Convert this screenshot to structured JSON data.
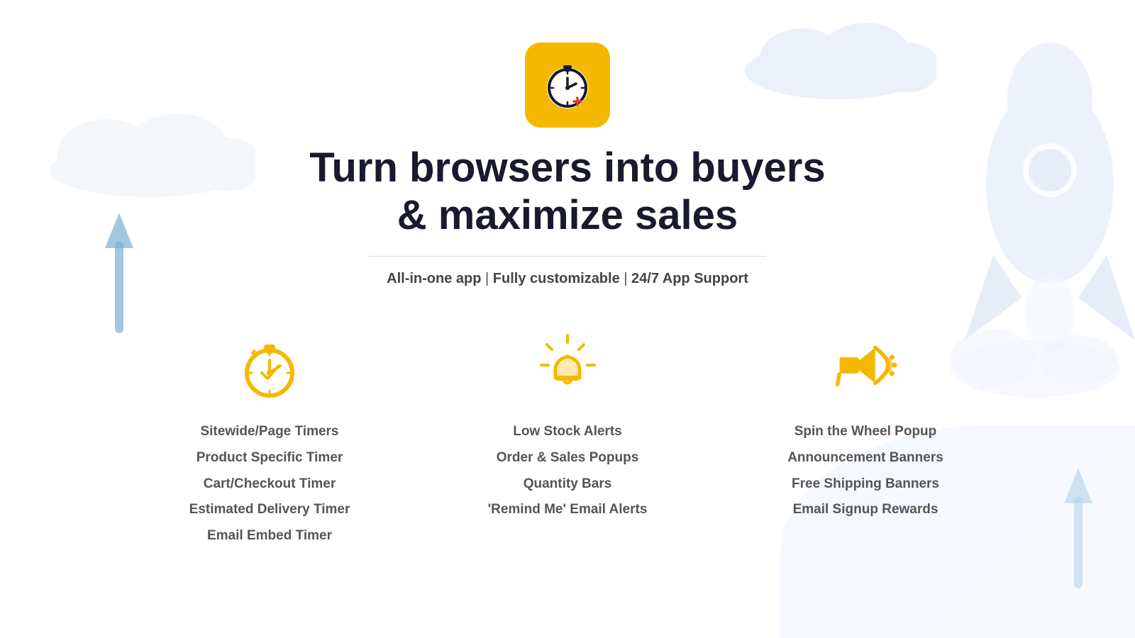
{
  "hero": {
    "title_line1": "Turn browsers into buyers",
    "title_line2": "& maximize sales",
    "subtitle": "All-in-one app | Fully customizable | 24/7 App Support",
    "app_icon_label": "Timer app icon"
  },
  "features": [
    {
      "id": "timers",
      "icon": "stopwatch-icon",
      "items": [
        "Sitewide/Page Timers",
        "Product Specific Timer",
        "Cart/Checkout Timer",
        "Estimated Delivery Timer",
        "Email Embed Timer"
      ]
    },
    {
      "id": "alerts",
      "icon": "alert-icon",
      "items": [
        "Low Stock Alerts",
        "Order & Sales Popups",
        "Quantity Bars",
        "'Remind Me' Email Alerts"
      ]
    },
    {
      "id": "banners",
      "icon": "megaphone-icon",
      "items": [
        "Spin the Wheel Popup",
        "Announcement Banners",
        "Free Shipping Banners",
        "Email Signup Rewards"
      ]
    }
  ],
  "colors": {
    "yellow": "#F5B800",
    "dark": "#1a1a2e",
    "gray": "#555555"
  }
}
